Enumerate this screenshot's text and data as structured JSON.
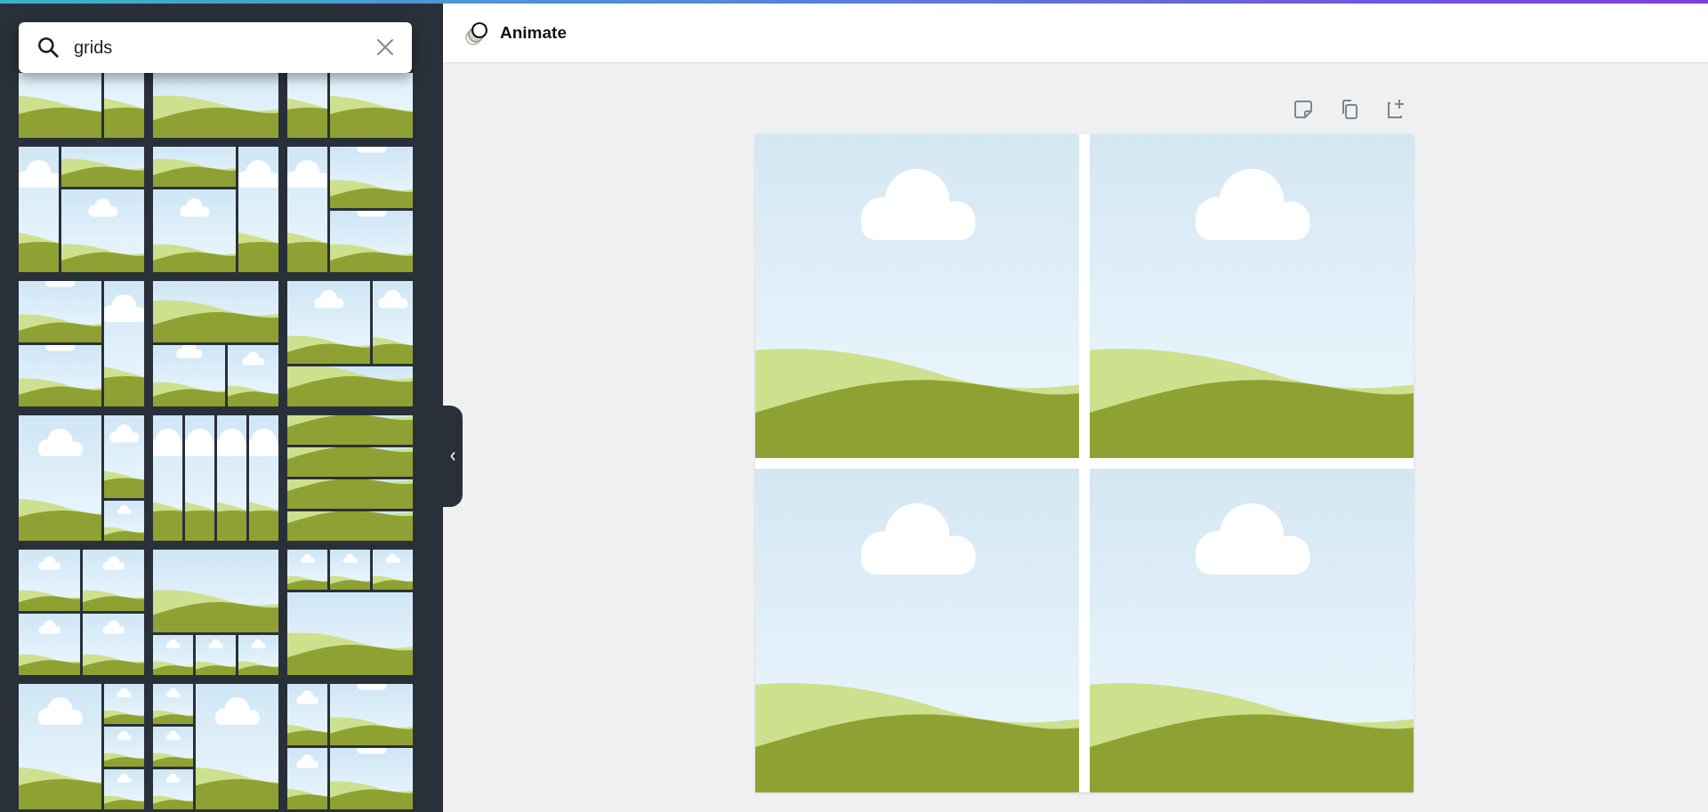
{
  "search": {
    "value": "grids"
  },
  "toolbar": {
    "animate_label": "Animate"
  }
}
